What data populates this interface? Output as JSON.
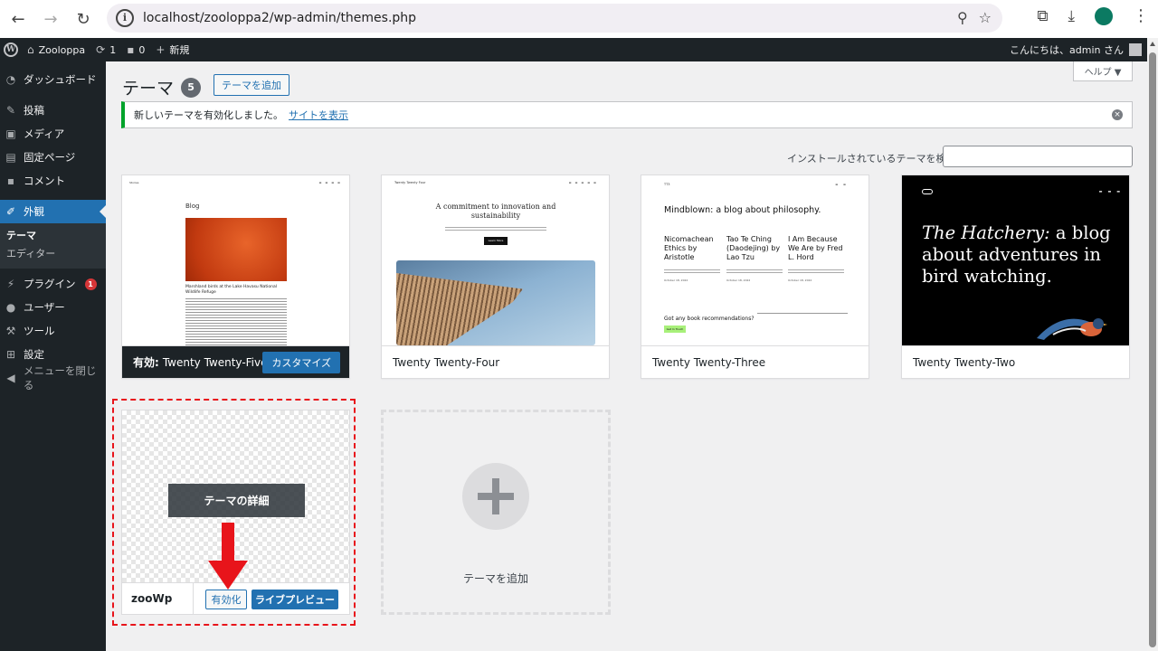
{
  "browser": {
    "url": "localhost/zooloppa2/wp-admin/themes.php",
    "info_icon": "info-icon"
  },
  "adminbar": {
    "site_name": "Zooloppa",
    "updates_count": "1",
    "comments_count": "0",
    "new_label": "新規",
    "greeting": "こんにちは、admin さん"
  },
  "sidebar": {
    "dashboard": "ダッシュボード",
    "posts": "投稿",
    "media": "メディア",
    "pages": "固定ページ",
    "comments": "コメント",
    "appearance": "外観",
    "sub_themes": "テーマ",
    "sub_editor": "エディター",
    "plugins": "プラグイン",
    "plugins_badge": "1",
    "users": "ユーザー",
    "tools": "ツール",
    "settings": "設定",
    "collapse": "メニューを閉じる"
  },
  "page": {
    "help_label": "ヘルプ ▼",
    "title": "テーマ",
    "theme_count": "5",
    "add_button": "テーマを追加",
    "notice_text": "新しいテーマを有効化しました。",
    "notice_link": "サイトを表示",
    "search_label": "インストールされているテーマを検索"
  },
  "themes": {
    "tt5": {
      "active_prefix": "有効:",
      "name": "Twenty Twenty-Five",
      "customize": "カスタマイズ",
      "shot_blog": "Blog",
      "shot_caption": "Marshland birds at the Lake Havasu National Wildlife Refuge",
      "shot_site": "Stories"
    },
    "tt4": {
      "name": "Twenty Twenty-Four",
      "shot_site": "Twenty Twenty Four",
      "shot_heading": "A commitment to innovation and sustainability",
      "shot_button": "Learn More"
    },
    "tt3": {
      "name": "Twenty Twenty-Three",
      "shot_site": "TT3",
      "shot_title": "Mindblown: a blog about philosophy.",
      "col1": "Nicomachean Ethics by Aristotle",
      "col2": "Tao Te Ching (Daodejing) by Lao Tzu",
      "col3": "I Am Because We Are by Fred L. Hord",
      "date1": "October 18, 2022",
      "date2": "October 18, 2022",
      "date3": "October 18, 2022",
      "question": "Got any book recommendations?",
      "shot_button": "Get In Touch"
    },
    "tt2": {
      "name": "Twenty Twenty-Two",
      "shot_title_italic": "The Hatchery:",
      "shot_title_rest": " a blog about adventures in bird watching."
    },
    "zoowp": {
      "name": "zooWp",
      "details": "テーマの詳細",
      "activate": "有効化",
      "live_preview": "ライブプレビュー"
    }
  },
  "add_theme_card": {
    "label": "テーマを追加"
  },
  "colors": {
    "wp_blue": "#2271b1",
    "admin_dark": "#1d2327",
    "notice_green": "#00a32a",
    "annotation_red": "#e8141b"
  }
}
